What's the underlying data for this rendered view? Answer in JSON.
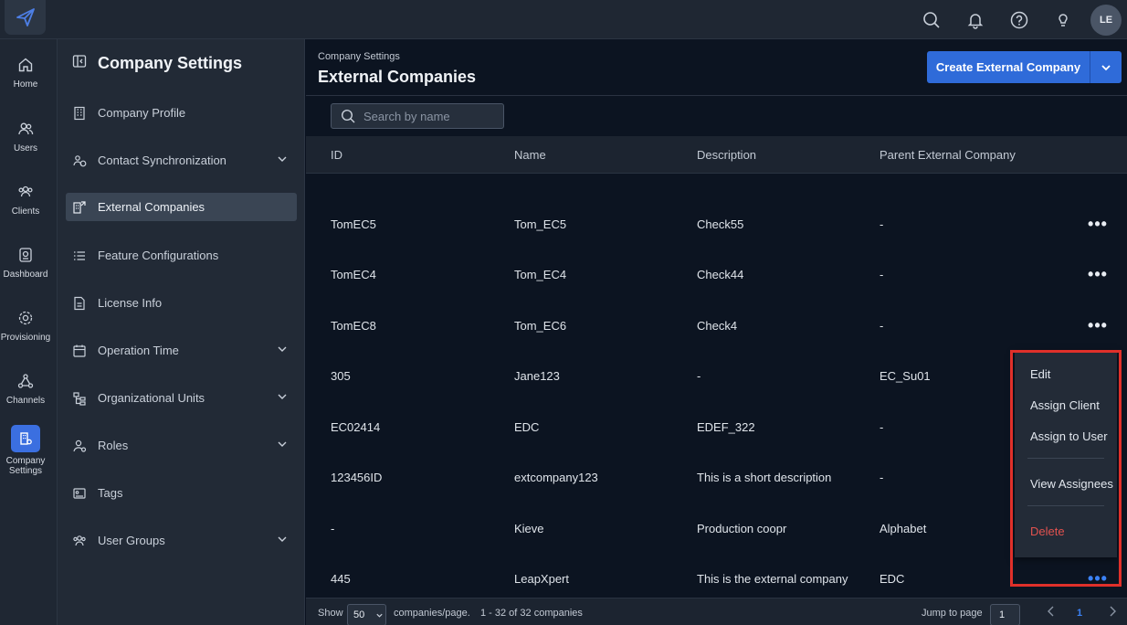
{
  "topbar": {
    "logo_icon": "paper-plane-logo",
    "icons": [
      "search-icon",
      "bell-icon",
      "help-icon",
      "lightbulb-icon"
    ],
    "avatar_initials": "LE"
  },
  "rail": {
    "items": [
      {
        "label": "Home",
        "icon": "home-icon"
      },
      {
        "label": "Users",
        "icon": "users-icon"
      },
      {
        "label": "Clients",
        "icon": "clients-icon"
      },
      {
        "label": "Dashboard",
        "icon": "dashboard-icon"
      },
      {
        "label": "Provisioning",
        "icon": "gear-icon"
      },
      {
        "label": "Channels",
        "icon": "channels-icon"
      },
      {
        "label": "Company Settings",
        "icon": "building-icon"
      }
    ],
    "active": "Company Settings"
  },
  "sidebar": {
    "title": "Company Settings",
    "items": [
      {
        "label": "Company Profile",
        "expandable": false
      },
      {
        "label": "Contact Synchronization",
        "expandable": true
      },
      {
        "label": "External Companies",
        "expandable": false
      },
      {
        "label": "Feature Configurations",
        "expandable": false
      },
      {
        "label": "License Info",
        "expandable": false
      },
      {
        "label": "Operation Time",
        "expandable": true
      },
      {
        "label": "Organizational Units",
        "expandable": true
      },
      {
        "label": "Roles",
        "expandable": true
      },
      {
        "label": "Tags",
        "expandable": false
      },
      {
        "label": "User Groups",
        "expandable": true
      }
    ],
    "active": "External Companies"
  },
  "header": {
    "breadcrumb": "Company Settings",
    "title": "External Companies",
    "create_label": "Create External Company"
  },
  "search": {
    "placeholder": "Search by name"
  },
  "table": {
    "columns": [
      "ID",
      "Name",
      "Description",
      "Parent External Company"
    ],
    "rows": [
      {
        "id": "TomEC5",
        "name": "Tom_EC5",
        "description": "Check55",
        "parent": "-"
      },
      {
        "id": "TomEC4",
        "name": "Tom_EC4",
        "description": "Check44",
        "parent": "-"
      },
      {
        "id": "TomEC8",
        "name": "Tom_EC6",
        "description": "Check4",
        "parent": "-"
      },
      {
        "id": "305",
        "name": "Jane123",
        "description": "-",
        "parent": "EC_Su01"
      },
      {
        "id": "EC02414",
        "name": "EDC",
        "description": "EDEF_322",
        "parent": "-"
      },
      {
        "id": "123456ID",
        "name": "extcompany123",
        "description": "This is a short description",
        "parent": "-"
      },
      {
        "id": "-",
        "name": "Kieve",
        "description": "Production coopr",
        "parent": "Alphabet"
      },
      {
        "id": "445",
        "name": "LeapXpert",
        "description": "This is the external company",
        "parent": "EDC"
      }
    ]
  },
  "menu": {
    "items": [
      "Edit",
      "Assign Client",
      "Assign to User",
      "View Assignees",
      "Delete"
    ],
    "highlight_color": "#e0302a"
  },
  "footer": {
    "show_label": "Show",
    "per_page": "50",
    "per_page_suffix": "companies/page.",
    "range": "1 - 32 of 32 companies",
    "jump_label": "Jump to page",
    "jump_value": "1",
    "current_page": "1"
  },
  "colors": {
    "accent": "#2f6bd9",
    "danger": "#e2524f",
    "active_dots": "#3b82f6"
  }
}
